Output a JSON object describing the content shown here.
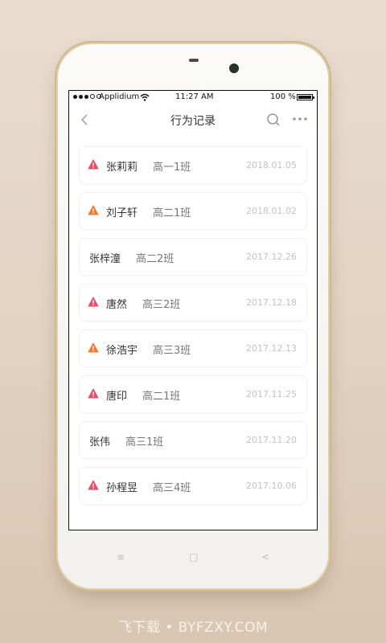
{
  "status_bar": {
    "carrier": "Applidium",
    "time": "11:27 AM",
    "battery": "100 %"
  },
  "nav": {
    "title": "行为记录"
  },
  "icons": {
    "back": "back-chevron-icon",
    "search": "search-icon",
    "more": "more-icon",
    "warning": "warning-triangle-icon"
  },
  "colors": {
    "warning_red": "#e94e6a",
    "warning_orange": "#f57a33",
    "date_gray": "#c3c3c3"
  },
  "records": [
    {
      "name": "张莉莉",
      "class": "高一1班",
      "date": "2018.01.05",
      "warning": "red"
    },
    {
      "name": "刘子轩",
      "class": "高二1班",
      "date": "2018.01.02",
      "warning": "orange"
    },
    {
      "name": "张梓潼",
      "class": "高二2班",
      "date": "2017.12.26",
      "warning": "none"
    },
    {
      "name": "唐然",
      "class": "高三2班",
      "date": "2017.12.18",
      "warning": "red"
    },
    {
      "name": "徐浩宇",
      "class": "高三3班",
      "date": "2017.12.13",
      "warning": "orange"
    },
    {
      "name": "唐印",
      "class": "高二1班",
      "date": "2017.11.25",
      "warning": "red"
    },
    {
      "name": "张伟",
      "class": "高三1班",
      "date": "2017.11.20",
      "warning": "none"
    },
    {
      "name": "孙程昱",
      "class": "高三4班",
      "date": "2017.10.06",
      "warning": "red"
    }
  ],
  "soft_keys": {
    "menu": "≡",
    "home": "□",
    "back": "<"
  },
  "watermark": "飞下载 • BYFZXY.COM"
}
